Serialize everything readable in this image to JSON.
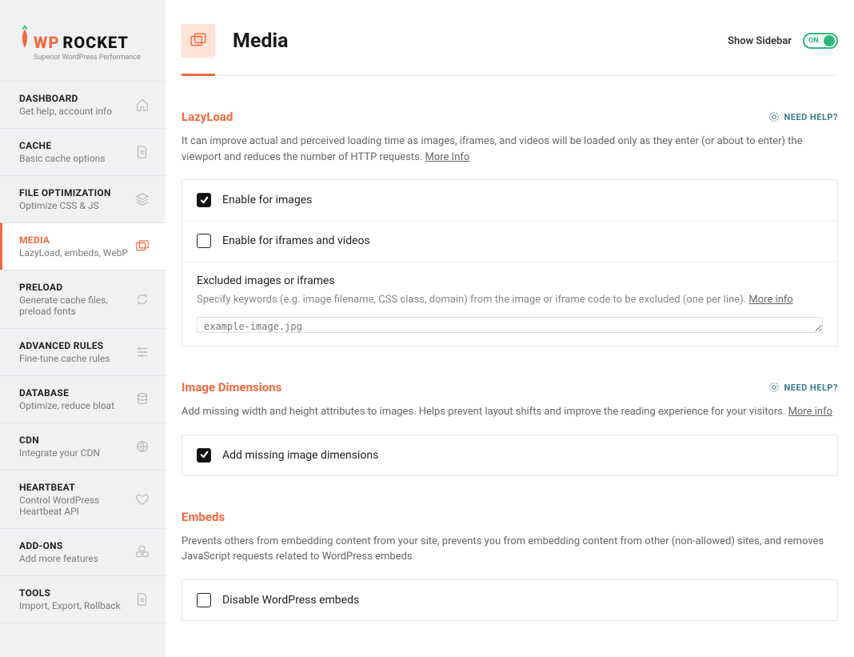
{
  "brand": {
    "wp": "WP",
    "rocket": "ROCKET",
    "tagline": "Superior WordPress Performance"
  },
  "nav": {
    "items": [
      {
        "key": "dashboard",
        "title": "DASHBOARD",
        "desc": "Get help, account info",
        "icon": "home"
      },
      {
        "key": "cache",
        "title": "CACHE",
        "desc": "Basic cache options",
        "icon": "doc"
      },
      {
        "key": "file-optimization",
        "title": "FILE OPTIMIZATION",
        "desc": "Optimize CSS & JS",
        "icon": "layers"
      },
      {
        "key": "media",
        "title": "MEDIA",
        "desc": "LazyLoad, embeds, WebP",
        "icon": "images",
        "active": true
      },
      {
        "key": "preload",
        "title": "PRELOAD",
        "desc": "Generate cache files, preload fonts",
        "icon": "refresh"
      },
      {
        "key": "advanced-rules",
        "title": "ADVANCED RULES",
        "desc": "Fine-tune cache rules",
        "icon": "sliders"
      },
      {
        "key": "database",
        "title": "DATABASE",
        "desc": "Optimize, reduce bloat",
        "icon": "database"
      },
      {
        "key": "cdn",
        "title": "CDN",
        "desc": "Integrate your CDN",
        "icon": "globe"
      },
      {
        "key": "heartbeat",
        "title": "HEARTBEAT",
        "desc": "Control WordPress Heartbeat API",
        "icon": "heart"
      },
      {
        "key": "addons",
        "title": "ADD-ONS",
        "desc": "Add more features",
        "icon": "cubes"
      },
      {
        "key": "tools",
        "title": "TOOLS",
        "desc": "Import, Export, Rollback",
        "icon": "tool"
      }
    ]
  },
  "header": {
    "title": "Media",
    "show_sidebar_label": "Show Sidebar",
    "toggle_text": "ON"
  },
  "help_label": "NEED HELP?",
  "lazyload": {
    "title": "LazyLoad",
    "desc": "It can improve actual and perceived loading time as images, iframes, and videos will be loaded only as they enter (or about to enter) the viewport and reduces the number of HTTP requests. ",
    "more": "More Info",
    "opt_images": "Enable for images",
    "opt_iframes": "Enable for iframes and videos",
    "excluded_title": "Excluded images or iframes",
    "excluded_desc": "Specify keywords (e.g. image filename, CSS class, domain) from the image or iframe code to be excluded (one per line). ",
    "excluded_more": "More info",
    "placeholder": "example-image.jpg"
  },
  "dimensions": {
    "title": "Image Dimensions",
    "desc": "Add missing width and height attributes to images. Helps prevent layout shifts and improve the reading experience for your visitors. ",
    "more": "More info",
    "opt_add": "Add missing image dimensions"
  },
  "embeds": {
    "title": "Embeds",
    "desc": "Prevents others from embedding content from your site, prevents you from embedding content from other (non-allowed) sites, and removes JavaScript requests related to WordPress embeds",
    "opt_disable": "Disable WordPress embeds"
  }
}
